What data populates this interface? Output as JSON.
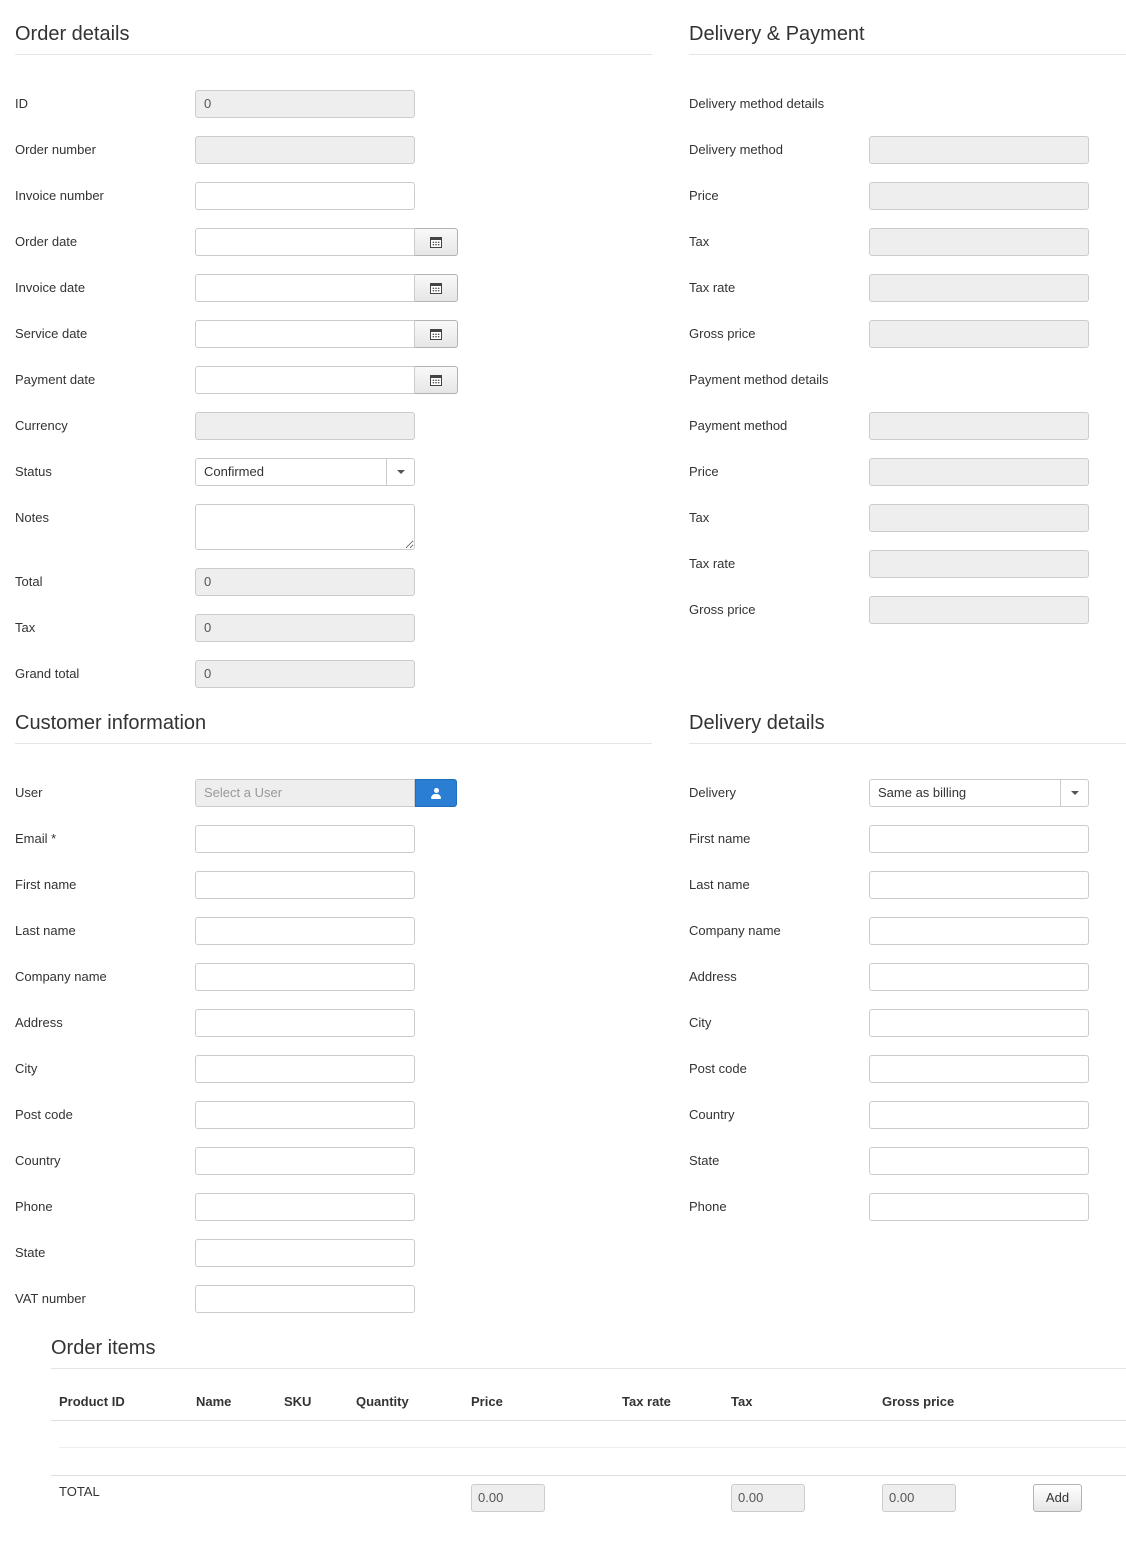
{
  "order_details": {
    "title": "Order details",
    "id": {
      "label": "ID",
      "value": "0"
    },
    "order_number": {
      "label": "Order number",
      "value": ""
    },
    "invoice_number": {
      "label": "Invoice number",
      "value": ""
    },
    "order_date": {
      "label": "Order date",
      "value": ""
    },
    "invoice_date": {
      "label": "Invoice date",
      "value": ""
    },
    "service_date": {
      "label": "Service date",
      "value": ""
    },
    "payment_date": {
      "label": "Payment date",
      "value": ""
    },
    "currency": {
      "label": "Currency",
      "value": ""
    },
    "status": {
      "label": "Status",
      "value": "Confirmed"
    },
    "notes": {
      "label": "Notes",
      "value": ""
    },
    "total": {
      "label": "Total",
      "value": "0"
    },
    "tax": {
      "label": "Tax",
      "value": "0"
    },
    "grand_total": {
      "label": "Grand total",
      "value": "0"
    }
  },
  "delivery_payment": {
    "title": "Delivery & Payment",
    "delivery_method_details": "Delivery method details",
    "delivery_method": {
      "label": "Delivery method",
      "value": ""
    },
    "delivery_price": {
      "label": "Price",
      "value": ""
    },
    "delivery_tax": {
      "label": "Tax",
      "value": ""
    },
    "delivery_tax_rate": {
      "label": "Tax rate",
      "value": ""
    },
    "delivery_gross_price": {
      "label": "Gross price",
      "value": ""
    },
    "payment_method_details": "Payment method details",
    "payment_method": {
      "label": "Payment method",
      "value": ""
    },
    "payment_price": {
      "label": "Price",
      "value": ""
    },
    "payment_tax": {
      "label": "Tax",
      "value": ""
    },
    "payment_tax_rate": {
      "label": "Tax rate",
      "value": ""
    },
    "payment_gross_price": {
      "label": "Gross price",
      "value": ""
    }
  },
  "customer": {
    "title": "Customer information",
    "user": {
      "label": "User",
      "placeholder": "Select a User"
    },
    "email": {
      "label": "Email *"
    },
    "first_name": {
      "label": "First name"
    },
    "last_name": {
      "label": "Last name"
    },
    "company_name": {
      "label": "Company name"
    },
    "address": {
      "label": "Address"
    },
    "city": {
      "label": "City"
    },
    "post_code": {
      "label": "Post code"
    },
    "country": {
      "label": "Country"
    },
    "phone": {
      "label": "Phone"
    },
    "state": {
      "label": "State"
    },
    "vat_number": {
      "label": "VAT number"
    }
  },
  "delivery": {
    "title": "Delivery details",
    "delivery": {
      "label": "Delivery",
      "value": "Same as billing"
    },
    "first_name": {
      "label": "First name"
    },
    "last_name": {
      "label": "Last name"
    },
    "company_name": {
      "label": "Company name"
    },
    "address": {
      "label": "Address"
    },
    "city": {
      "label": "City"
    },
    "post_code": {
      "label": "Post code"
    },
    "country": {
      "label": "Country"
    },
    "state": {
      "label": "State"
    },
    "phone": {
      "label": "Phone"
    }
  },
  "order_items": {
    "title": "Order items",
    "columns": [
      "Product ID",
      "Name",
      "SKU",
      "Quantity",
      "Price",
      "Tax rate",
      "Tax",
      "Gross price"
    ],
    "total_label": "TOTAL",
    "price_total": "0.00",
    "tax_total": "0.00",
    "gross_total": "0.00",
    "add_label": "Add"
  },
  "colors": {
    "accent": "#2a7fd4",
    "readonly_bg": "#eeeeee",
    "border": "#cccccc"
  }
}
